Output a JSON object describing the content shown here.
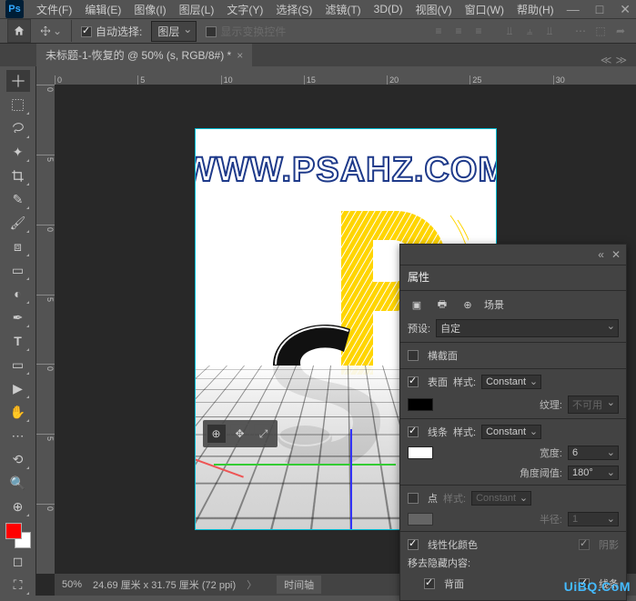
{
  "menubar": {
    "items": [
      "文件(F)",
      "编辑(E)",
      "图像(I)",
      "图层(L)",
      "文字(Y)",
      "选择(S)",
      "滤镜(T)",
      "3D(D)",
      "视图(V)",
      "窗口(W)",
      "帮助(H)"
    ]
  },
  "optionsbar": {
    "auto_select_label": "自动选择:",
    "auto_select_target": "图层",
    "show_transform_label": "显示变换控件"
  },
  "document": {
    "tab_title": "未标题-1-恢复的 @ 50% (s, RGB/8#) *",
    "zoom": "50%",
    "dimensions": "24.69 厘米 x 31.75 厘米 (72 ppi)",
    "timeline_tab": "时间轴"
  },
  "ruler": {
    "h": [
      "0",
      "5",
      "10",
      "15",
      "20",
      "25",
      "30"
    ],
    "v": [
      "0",
      "5",
      "1",
      "0",
      "1",
      "5",
      "2",
      "0",
      "2",
      "5",
      "3",
      "0"
    ]
  },
  "watermark": "WWW.PSAHZ.COM",
  "footer_credit": "UiBQ.CoM",
  "properties": {
    "title": "属性",
    "scene_label": "场景",
    "preset_label": "预设:",
    "preset_value": "自定",
    "cross_section": "横截面",
    "surface": "表面",
    "style_label": "样式:",
    "style_surface": "Constant",
    "texture_label": "纹理:",
    "texture_value": "不可用",
    "lines": "线条",
    "style_lines": "Constant",
    "width_label": "宽度:",
    "width_value": "6",
    "angle_label": "角度阈值:",
    "angle_value": "180°",
    "points": "点",
    "style_points": "Constant",
    "radius_label": "半径:",
    "radius_value": "1",
    "linearize": "线性化颜色",
    "remove_hidden": "移去隐藏内容:",
    "backface": "背面",
    "shadow": "阴影",
    "lines2": "线条",
    "swatch_surface": "#000000",
    "swatch_lines": "#ffffff",
    "swatch_points": "#cccccc"
  }
}
